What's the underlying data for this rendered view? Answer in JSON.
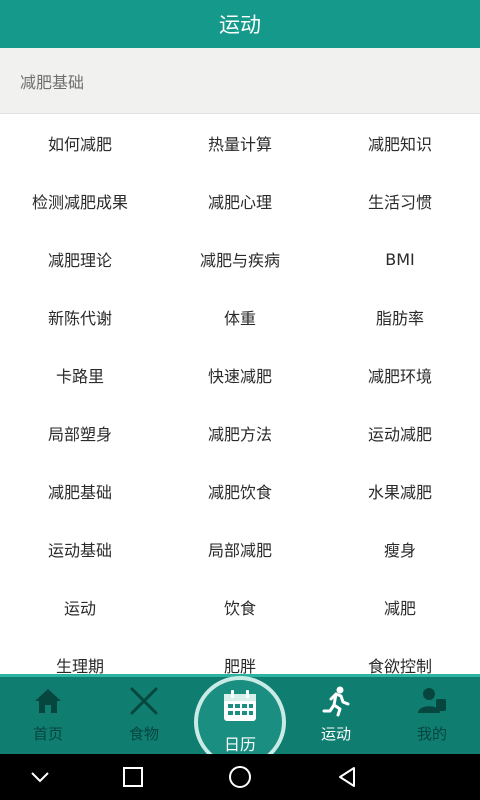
{
  "header": {
    "title": "运动"
  },
  "section": {
    "title": "减肥基础"
  },
  "grid_rows": [
    [
      "如何减肥",
      "热量计算",
      "减肥知识"
    ],
    [
      "检测减肥成果",
      "减肥心理",
      "生活习惯"
    ],
    [
      "减肥理论",
      "减肥与疾病",
      "BMI"
    ],
    [
      "新陈代谢",
      "体重",
      "脂肪率"
    ],
    [
      "卡路里",
      "快速减肥",
      "减肥环境"
    ],
    [
      "局部塑身",
      "减肥方法",
      "运动减肥"
    ],
    [
      "减肥基础",
      "减肥饮食",
      "水果减肥"
    ],
    [
      "运动基础",
      "局部减肥",
      "瘦身"
    ],
    [
      "运动",
      "饮食",
      "减肥"
    ],
    [
      "生理期",
      "肥胖",
      "食欲控制"
    ]
  ],
  "tabbar": {
    "home": {
      "label": "首页",
      "icon": "home-icon"
    },
    "food": {
      "label": "食物",
      "icon": "utensils-icon"
    },
    "calendar": {
      "label": "日历",
      "icon": "calendar-icon"
    },
    "sport": {
      "label": "运动",
      "icon": "running-icon"
    },
    "mine": {
      "label": "我的",
      "icon": "user-icon"
    }
  },
  "colors": {
    "primary": "#14998a",
    "tabbar": "#0f7d70",
    "tab_inactive": "#06463f",
    "tab_active": "#ffffff"
  }
}
